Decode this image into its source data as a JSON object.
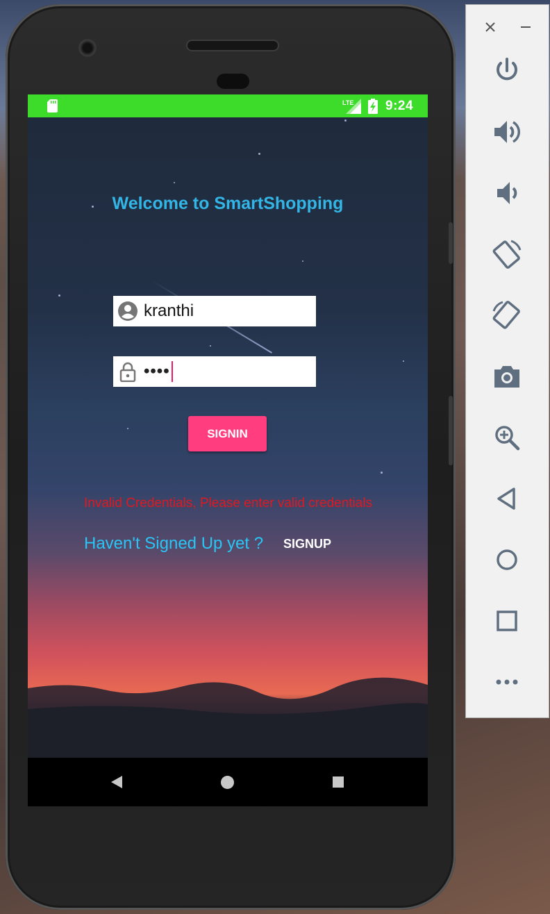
{
  "status_bar": {
    "time": "9:24",
    "network": "LTE"
  },
  "app": {
    "title": "Welcome to SmartShopping",
    "username": {
      "value": "kranthi"
    },
    "password": {
      "masked_value": "••••"
    },
    "signin_label": "SIGNIN",
    "error_message": "Invalid Credentials, Please enter valid credentials",
    "signup_prompt": "Haven't Signed Up yet ?",
    "signup_label": "SIGNUP"
  },
  "colors": {
    "status_bar": "#3ddc2a",
    "title": "#33b5e5",
    "signin_button": "#ff3d7f",
    "error": "#e01820",
    "prompt": "#29c5f6"
  },
  "emulator_toolbar": {
    "items": [
      "close-icon",
      "minimize-icon",
      "power-icon",
      "volume-up-icon",
      "volume-down-icon",
      "rotate-left-icon",
      "rotate-right-icon",
      "camera-icon",
      "zoom-icon",
      "back-icon",
      "home-icon",
      "overview-icon",
      "more-icon"
    ]
  }
}
